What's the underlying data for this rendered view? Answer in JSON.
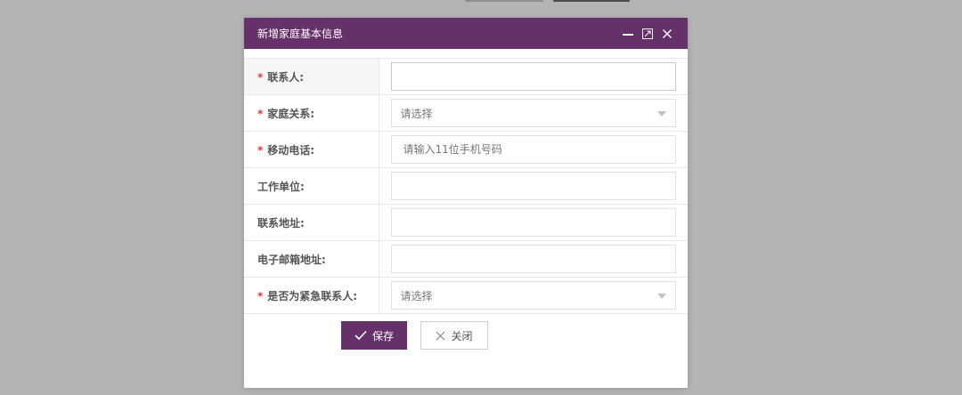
{
  "dialog": {
    "title": "新增家庭基本信息",
    "controls": [
      "minimize-icon",
      "maximize-icon",
      "close-icon"
    ]
  },
  "form": {
    "fields": [
      {
        "label": "联系人:",
        "required": true,
        "type": "input",
        "value": "",
        "placeholder": ""
      },
      {
        "label": "家庭关系:",
        "required": true,
        "type": "select",
        "selected": "请选择"
      },
      {
        "label": "移动电话:",
        "required": true,
        "type": "input",
        "value": "",
        "placeholder": "请输入11位手机号码"
      },
      {
        "label": "工作单位:",
        "required": false,
        "type": "input",
        "value": "",
        "placeholder": ""
      },
      {
        "label": "联系地址:",
        "required": false,
        "type": "input",
        "value": "",
        "placeholder": ""
      },
      {
        "label": "电子邮箱地址:",
        "required": false,
        "type": "input",
        "value": "",
        "placeholder": ""
      },
      {
        "label": "是否为紧急联系人:",
        "required": true,
        "type": "select",
        "selected": "请选择"
      }
    ],
    "required_mark": "*"
  },
  "actions": {
    "save_label": "保存",
    "close_label": "关闭"
  },
  "colors": {
    "accent": "#66316a",
    "required": "#e4393c",
    "overlay": "#b4b4b4"
  }
}
